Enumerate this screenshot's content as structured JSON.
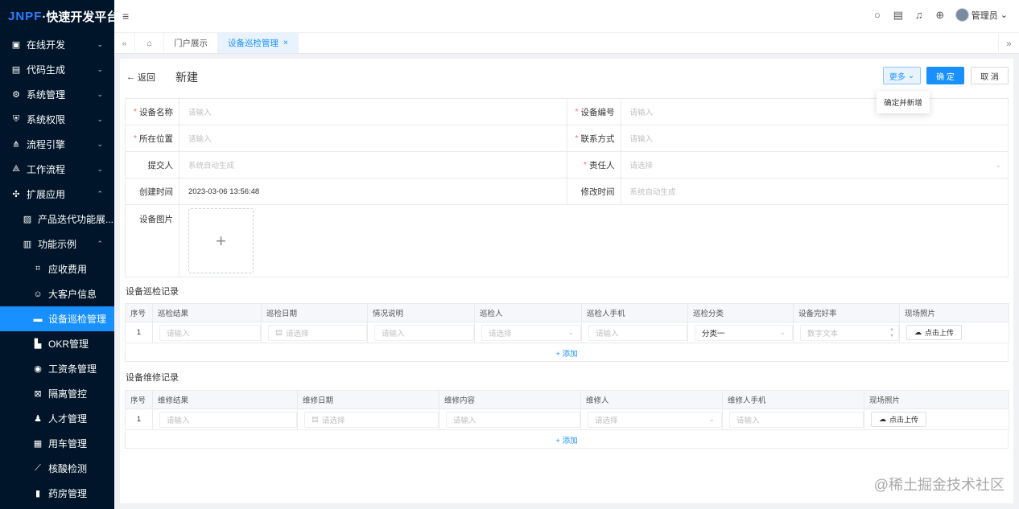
{
  "app": {
    "brand": "JNPF",
    "name": "·快速开发平台"
  },
  "sidebar": {
    "items": [
      {
        "label": "在线开发",
        "icon": "image-icon",
        "glyph": "▣",
        "level": 1,
        "chev": "⌄"
      },
      {
        "label": "代码生成",
        "icon": "code-icon",
        "glyph": "▤",
        "level": 1,
        "chev": "⌄"
      },
      {
        "label": "系统管理",
        "icon": "gear-icon",
        "glyph": "⚙",
        "level": 1,
        "chev": "⌄"
      },
      {
        "label": "系统权限",
        "icon": "shield-icon",
        "glyph": "⛨",
        "level": 1,
        "chev": "⌄"
      },
      {
        "label": "流程引擎",
        "icon": "flow-icon",
        "glyph": "⋔",
        "level": 1,
        "chev": "⌄"
      },
      {
        "label": "工作流程",
        "icon": "workflow-icon",
        "glyph": "⟁",
        "level": 1,
        "chev": "⌄"
      },
      {
        "label": "扩展应用",
        "icon": "apps-icon",
        "glyph": "✣",
        "level": 1,
        "chev": "⌃"
      },
      {
        "label": "产品迭代功能展...",
        "icon": "gallery-icon",
        "glyph": "▨",
        "level": 2,
        "chev": "⌄"
      },
      {
        "label": "功能示例",
        "icon": "chart-icon",
        "glyph": "▥",
        "level": 2,
        "chev": "⌃"
      },
      {
        "label": "应收费用",
        "icon": "scan-icon",
        "glyph": "⌗",
        "level": 3,
        "chev": ""
      },
      {
        "label": "大客户信息",
        "icon": "smile-icon",
        "glyph": "☺",
        "level": 3,
        "chev": ""
      },
      {
        "label": "设备巡检管理",
        "icon": "briefcase-icon",
        "glyph": "▬",
        "level": 3,
        "chev": "",
        "active": true
      },
      {
        "label": "OKR管理",
        "icon": "okr-icon",
        "glyph": "▙",
        "level": 3,
        "chev": ""
      },
      {
        "label": "工资条管理",
        "icon": "money-icon",
        "glyph": "◉",
        "level": 3,
        "chev": ""
      },
      {
        "label": "隔离管控",
        "icon": "isolation-icon",
        "glyph": "⊠",
        "level": 3,
        "chev": ""
      },
      {
        "label": "人才管理",
        "icon": "person-icon",
        "glyph": "♟",
        "level": 3,
        "chev": ""
      },
      {
        "label": "用车管理",
        "icon": "car-icon",
        "glyph": "▦",
        "level": 3,
        "chev": ""
      },
      {
        "label": "核酸检测",
        "icon": "test-icon",
        "glyph": "⟋",
        "level": 3,
        "chev": ""
      },
      {
        "label": "药房管理",
        "icon": "pharmacy-icon",
        "glyph": "▮",
        "level": 3,
        "chev": ""
      }
    ]
  },
  "topbar": {
    "fold_icon": "≡",
    "search_icon": "○",
    "msg_icon": "▤",
    "bell_icon": "♫",
    "globe_icon": "⊕",
    "user": "管理员",
    "user_chev": "⌄"
  },
  "tabs": [
    {
      "label": "«",
      "kind": "arrow",
      "icon": "double-left-icon"
    },
    {
      "label": "⌂",
      "kind": "home",
      "icon": "home-icon"
    },
    {
      "label": "门户展示",
      "kind": "tab"
    },
    {
      "label": "设备巡检管理",
      "kind": "active",
      "close": "×"
    }
  ],
  "tabs_end": "»",
  "page": {
    "back": "返回",
    "back_arrow": "←",
    "title": "新建",
    "more": "更多",
    "more_chev": "⌄",
    "ok": "确 定",
    "cancel": "取 消",
    "dropdown_item": "确定并新增"
  },
  "form": {
    "name_label": "设备名称",
    "name_ph": "请输入",
    "code_label": "设备编号",
    "code_ph": "请输入",
    "location_label": "所在位置",
    "location_ph": "请输入",
    "contact_label": "联系方式",
    "contact_ph": "请输入",
    "submitter_label": "提交人",
    "submitter_val": "系统自动生成",
    "owner_label": "责任人",
    "owner_ph": "请选择",
    "created_label": "创建时间",
    "created_val": "2023-03-06 13:56:48",
    "modified_label": "修改时间",
    "modified_val": "系统自动生成",
    "image_label": "设备图片",
    "upload_glyph": "+"
  },
  "inspection": {
    "title": "设备巡检记录",
    "headers": [
      "序号",
      "巡检结果",
      "巡检日期",
      "情况说明",
      "巡检人",
      "巡检人手机",
      "巡检分类",
      "设备完好率",
      "现场照片"
    ],
    "row": {
      "num": "1",
      "result": "请输入",
      "date": "请选择",
      "desc": "请输入",
      "person": "请选择",
      "phone": "请输入",
      "category": "分类一",
      "rate": "数字文本",
      "photo": "点击上传"
    },
    "add": "+ 添加"
  },
  "repair": {
    "title": "设备维修记录",
    "headers": [
      "序号",
      "维修结果",
      "维修日期",
      "维修内容",
      "维修人",
      "维修人手机",
      "现场照片"
    ],
    "row": {
      "num": "1",
      "result": "请输入",
      "date": "请选择",
      "content": "请输入",
      "person": "请选择",
      "phone": "请输入",
      "photo": "点击上传"
    },
    "add": "+ 添加"
  },
  "watermark": "@稀土掘金技术社区",
  "colors": {
    "accent": "#1890ff",
    "sidebar": "#001529"
  }
}
